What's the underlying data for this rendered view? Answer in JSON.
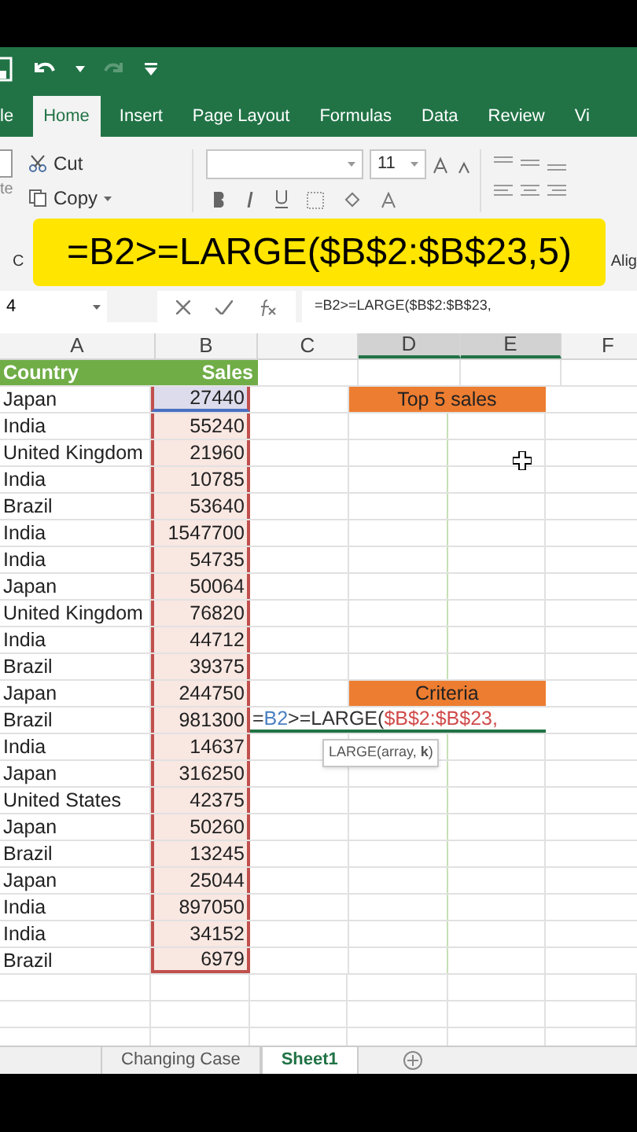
{
  "caption": "=B2>=LARGE($B$2:$B$23,5)",
  "ribbon_tabs": [
    {
      "label": "le",
      "selected": false
    },
    {
      "label": "Home",
      "selected": true
    },
    {
      "label": "Insert",
      "selected": false
    },
    {
      "label": "Page Layout",
      "selected": false
    },
    {
      "label": "Formulas",
      "selected": false
    },
    {
      "label": "Data",
      "selected": false
    },
    {
      "label": "Review",
      "selected": false
    },
    {
      "label": "Vi",
      "selected": false
    }
  ],
  "clipboard": {
    "paste": "te",
    "cut": "Cut",
    "copy": "Copy",
    "group": "C"
  },
  "font": {
    "size": "11"
  },
  "alignment_group": "Alig",
  "formula_bar": {
    "name_box": "4",
    "value": "=B2>=LARGE($B$2:$B$23,"
  },
  "columns": [
    {
      "label": "A",
      "selected": false
    },
    {
      "label": "B",
      "selected": false
    },
    {
      "label": "C",
      "selected": false
    },
    {
      "label": "D",
      "selected": true
    },
    {
      "label": "E",
      "selected": true
    },
    {
      "label": "F",
      "selected": false
    }
  ],
  "header": {
    "country": "Country",
    "sales": "Sales"
  },
  "rows": [
    {
      "country": "Japan",
      "sales": "27440",
      "active": true,
      "label": "Top 5 sales"
    },
    {
      "country": "India",
      "sales": "55240",
      "active": false
    },
    {
      "country": "United Kingdom",
      "sales": "21960",
      "active": false
    },
    {
      "country": "India",
      "sales": "10785",
      "active": false
    },
    {
      "country": "Brazil",
      "sales": "53640",
      "active": false
    },
    {
      "country": "India",
      "sales": "1547700",
      "active": false
    },
    {
      "country": "India",
      "sales": "54735",
      "active": false
    },
    {
      "country": "Japan",
      "sales": "50064",
      "active": false
    },
    {
      "country": "United Kingdom",
      "sales": "76820",
      "active": false
    },
    {
      "country": "India",
      "sales": "44712",
      "active": false
    },
    {
      "country": "Brazil",
      "sales": "39375",
      "active": false
    },
    {
      "country": "Japan",
      "sales": "244750",
      "active": false,
      "label": "Criteria"
    },
    {
      "country": "Brazil",
      "sales": "981300",
      "active": false,
      "editor": [
        {
          "text": "=",
          "color": "#333333"
        },
        {
          "text": "B2",
          "color": "#4a7fc1"
        },
        {
          "text": ">=LARGE(",
          "color": "#333333"
        },
        {
          "text": "$B$2:$B$23,",
          "color": "#d04a4a"
        }
      ]
    },
    {
      "country": "India",
      "sales": "14637",
      "active": false
    },
    {
      "country": "Japan",
      "sales": "316250",
      "active": false
    },
    {
      "country": "United States",
      "sales": "42375",
      "active": false
    },
    {
      "country": "Japan",
      "sales": "50260",
      "active": false
    },
    {
      "country": "Brazil",
      "sales": "13245",
      "active": false
    },
    {
      "country": "Japan",
      "sales": "25044",
      "active": false
    },
    {
      "country": "India",
      "sales": "897050",
      "active": false
    },
    {
      "country": "India",
      "sales": "34152",
      "active": false
    },
    {
      "country": "Brazil",
      "sales": "6979",
      "active": false
    }
  ],
  "tooltip": "LARGE(array, **k**)",
  "sheet_tabs": [
    {
      "label": "Changing Case",
      "selected": false
    },
    {
      "label": "Sheet1",
      "selected": true
    }
  ]
}
